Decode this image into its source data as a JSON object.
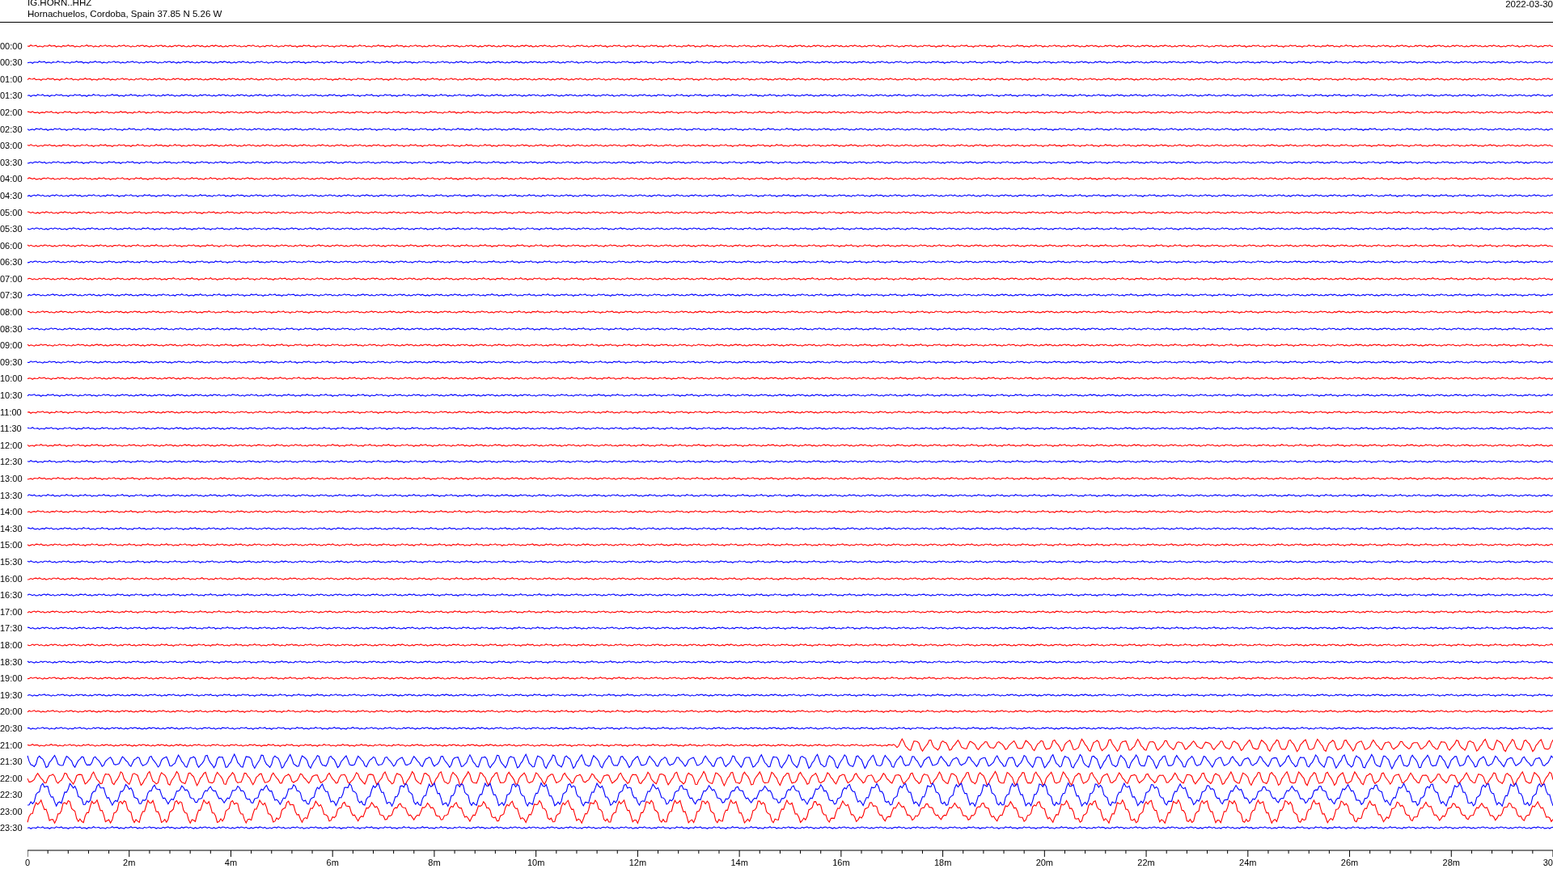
{
  "header": {
    "station": "IG.HORN..HHZ",
    "location": "Hornachuelos, Cordoba, Spain  37.85 N 5.26 W",
    "date": "2022-03-30"
  },
  "traces": [
    {
      "time": "00:00",
      "color": "#ff0000",
      "kind": "quiet"
    },
    {
      "time": "00:30",
      "color": "#0000ff",
      "kind": "quiet"
    },
    {
      "time": "01:00",
      "color": "#ff0000",
      "kind": "quiet"
    },
    {
      "time": "01:30",
      "color": "#0000ff",
      "kind": "quiet"
    },
    {
      "time": "02:00",
      "color": "#ff0000",
      "kind": "quiet"
    },
    {
      "time": "02:30",
      "color": "#0000ff",
      "kind": "quiet"
    },
    {
      "time": "03:00",
      "color": "#ff0000",
      "kind": "quiet"
    },
    {
      "time": "03:30",
      "color": "#0000ff",
      "kind": "quiet"
    },
    {
      "time": "04:00",
      "color": "#ff0000",
      "kind": "quiet"
    },
    {
      "time": "04:30",
      "color": "#0000ff",
      "kind": "quiet"
    },
    {
      "time": "05:00",
      "color": "#ff0000",
      "kind": "quiet"
    },
    {
      "time": "05:30",
      "color": "#0000ff",
      "kind": "quiet"
    },
    {
      "time": "06:00",
      "color": "#ff0000",
      "kind": "quiet"
    },
    {
      "time": "06:30",
      "color": "#0000ff",
      "kind": "quiet"
    },
    {
      "time": "07:00",
      "color": "#ff0000",
      "kind": "quiet"
    },
    {
      "time": "07:30",
      "color": "#0000ff",
      "kind": "quiet"
    },
    {
      "time": "08:00",
      "color": "#ff0000",
      "kind": "quiet"
    },
    {
      "time": "08:30",
      "color": "#0000ff",
      "kind": "quiet"
    },
    {
      "time": "09:00",
      "color": "#ff0000",
      "kind": "quiet"
    },
    {
      "time": "09:30",
      "color": "#0000ff",
      "kind": "quiet"
    },
    {
      "time": "10:00",
      "color": "#ff0000",
      "kind": "quiet"
    },
    {
      "time": "10:30",
      "color": "#0000ff",
      "kind": "quiet"
    },
    {
      "time": "11:00",
      "color": "#ff0000",
      "kind": "quiet"
    },
    {
      "time": "11:30",
      "color": "#0000ff",
      "kind": "quiet"
    },
    {
      "time": "12:00",
      "color": "#ff0000",
      "kind": "quiet"
    },
    {
      "time": "12:30",
      "color": "#0000ff",
      "kind": "quiet"
    },
    {
      "time": "13:00",
      "color": "#ff0000",
      "kind": "quiet"
    },
    {
      "time": "13:30",
      "color": "#0000ff",
      "kind": "quiet"
    },
    {
      "time": "14:00",
      "color": "#ff0000",
      "kind": "quiet"
    },
    {
      "time": "14:30",
      "color": "#0000ff",
      "kind": "quiet"
    },
    {
      "time": "15:00",
      "color": "#ff0000",
      "kind": "quiet"
    },
    {
      "time": "15:30",
      "color": "#0000ff",
      "kind": "quiet"
    },
    {
      "time": "16:00",
      "color": "#ff0000",
      "kind": "quiet"
    },
    {
      "time": "16:30",
      "color": "#0000ff",
      "kind": "quiet"
    },
    {
      "time": "17:00",
      "color": "#ff0000",
      "kind": "quiet"
    },
    {
      "time": "17:30",
      "color": "#0000ff",
      "kind": "quiet"
    },
    {
      "time": "18:00",
      "color": "#ff0000",
      "kind": "quiet"
    },
    {
      "time": "18:30",
      "color": "#0000ff",
      "kind": "quiet"
    },
    {
      "time": "19:00",
      "color": "#ff0000",
      "kind": "quiet"
    },
    {
      "time": "19:30",
      "color": "#0000ff",
      "kind": "quiet"
    },
    {
      "time": "20:00",
      "color": "#ff0000",
      "kind": "quiet"
    },
    {
      "time": "20:30",
      "color": "#0000ff",
      "kind": "quiet"
    },
    {
      "time": "21:00",
      "color": "#ff0000",
      "kind": "onset"
    },
    {
      "time": "21:30",
      "color": "#0000ff",
      "kind": "moderate"
    },
    {
      "time": "22:00",
      "color": "#ff0000",
      "kind": "moderate"
    },
    {
      "time": "22:30",
      "color": "#0000ff",
      "kind": "strong"
    },
    {
      "time": "23:00",
      "color": "#ff0000",
      "kind": "strong"
    },
    {
      "time": "23:30",
      "color": "#0000ff",
      "kind": "quiet"
    }
  ],
  "x_axis": {
    "labels": [
      "0",
      "2m",
      "4m",
      "6m",
      "8m",
      "10m",
      "12m",
      "14m",
      "16m",
      "18m",
      "20m",
      "22m",
      "24m",
      "26m",
      "28m",
      "30"
    ]
  }
}
